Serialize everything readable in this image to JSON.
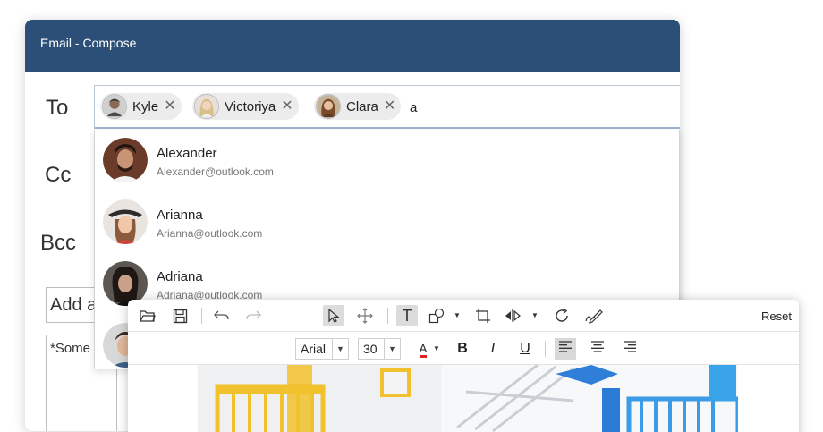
{
  "compose": {
    "title": "Email - Compose",
    "labels": {
      "to": "To",
      "cc": "Cc",
      "bcc": "Bcc"
    },
    "recipients": [
      {
        "name": "Kyle",
        "remove": "✕"
      },
      {
        "name": "Victoriya",
        "remove": "✕"
      },
      {
        "name": "Clara",
        "remove": "✕"
      }
    ],
    "to_input_value": "a",
    "subject_placeholder": "Add a subject",
    "body_value": "*Some text here"
  },
  "suggestions": [
    {
      "name": "Alexander",
      "email": "Alexander@outlook.com"
    },
    {
      "name": "Arianna",
      "email": "Arianna@outlook.com"
    },
    {
      "name": "Adriana",
      "email": "Adriana@outlook.com"
    }
  ],
  "editor": {
    "reset_label": "Reset",
    "font_family": "Arial",
    "font_size": "30",
    "font_color_letter": "A",
    "bold": "B",
    "italic": "I",
    "underline": "U",
    "text_tool": "T",
    "colors": {
      "header": "#2b4f76",
      "font_color": "#e02020"
    }
  }
}
